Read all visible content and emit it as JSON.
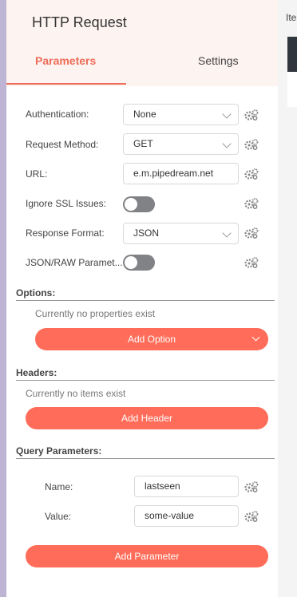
{
  "panel": {
    "title": "HTTP Request",
    "tabs": [
      {
        "label": "Parameters",
        "active": true
      },
      {
        "label": "Settings",
        "active": false
      }
    ]
  },
  "right_pane": {
    "label_fragment": "Ite"
  },
  "fields": {
    "authentication": {
      "label": "Authentication:",
      "value": "None"
    },
    "request_method": {
      "label": "Request Method:",
      "value": "GET"
    },
    "url": {
      "label": "URL:",
      "value": "e.m.pipedream.net"
    },
    "ignore_ssl": {
      "label": "Ignore SSL Issues:",
      "on": false
    },
    "response_format": {
      "label": "Response Format:",
      "value": "JSON"
    },
    "json_raw": {
      "label": "JSON/RAW Paramet...",
      "on": false
    }
  },
  "options": {
    "title": "Options:",
    "empty_text": "Currently no properties exist",
    "add_label": "Add Option"
  },
  "headers": {
    "title": "Headers:",
    "empty_text": "Currently no items exist",
    "add_label": "Add Header"
  },
  "query": {
    "title": "Query Parameters:",
    "name": {
      "label": "Name:",
      "value": "lastseen"
    },
    "value": {
      "label": "Value:",
      "value": "some-value"
    },
    "add_label": "Add Parameter"
  },
  "colors": {
    "accent": "#ef6c58",
    "button": "#ff6d5a",
    "toggle_off": "#808285",
    "left_strip": "#bdb5d3"
  },
  "icons": {
    "parameter_options": "gears-icon",
    "dropdown": "chevron-down-icon"
  }
}
